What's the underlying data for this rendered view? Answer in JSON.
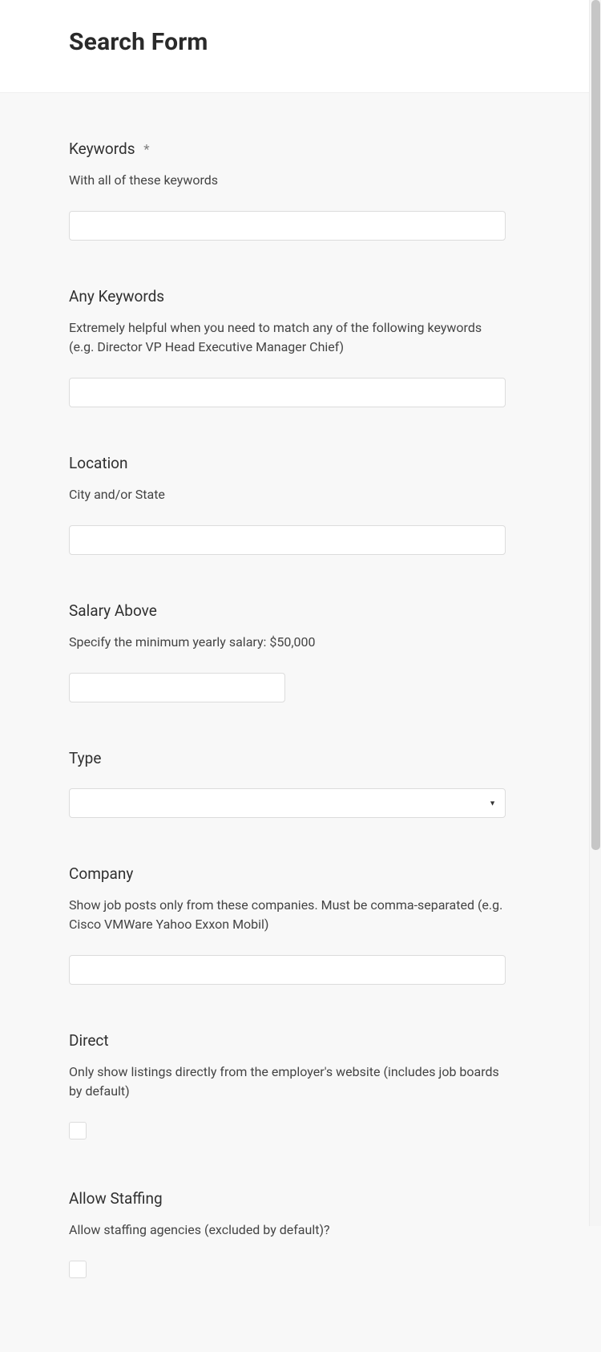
{
  "header": {
    "title": "Search Form"
  },
  "form": {
    "keywords": {
      "label": "Keywords",
      "required_marker": "*",
      "description": "With all of these keywords",
      "value": ""
    },
    "any_keywords": {
      "label": "Any Keywords",
      "description": "Extremely helpful when you need to match any of the following keywords (e.g. Director VP Head Executive Manager Chief)",
      "value": ""
    },
    "location": {
      "label": "Location",
      "description": "City and/or State",
      "value": ""
    },
    "salary_above": {
      "label": "Salary Above",
      "description": "Specify the minimum yearly salary: $50,000",
      "value": ""
    },
    "type": {
      "label": "Type",
      "selected": ""
    },
    "company": {
      "label": "Company",
      "description": "Show job posts only from these companies. Must be comma-separated (e.g. Cisco VMWare Yahoo Exxon Mobil)",
      "value": ""
    },
    "direct": {
      "label": "Direct",
      "description": "Only show listings directly from the employer's website (includes job boards by default)",
      "checked": false
    },
    "allow_staffing": {
      "label": "Allow Staffing",
      "description": "Allow staffing agencies (excluded by default)?",
      "checked": false
    }
  }
}
